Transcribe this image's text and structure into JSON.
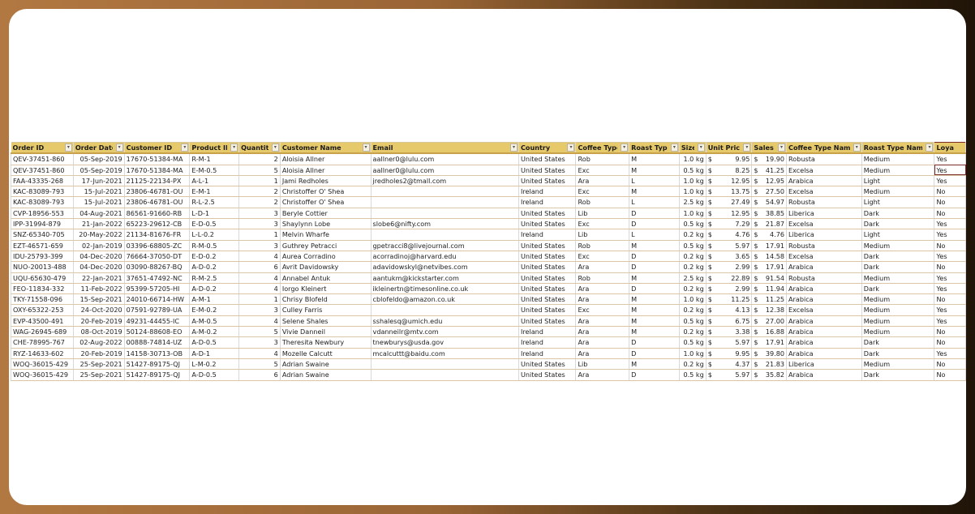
{
  "sheet": {
    "columns": [
      {
        "key": "order_id",
        "label": "Order ID"
      },
      {
        "key": "order_date",
        "label": "Order Date"
      },
      {
        "key": "customer_id",
        "label": "Customer ID"
      },
      {
        "key": "product_id",
        "label": "Product ID"
      },
      {
        "key": "quantity",
        "label": "Quantity"
      },
      {
        "key": "customer_name",
        "label": "Customer Name"
      },
      {
        "key": "email",
        "label": "Email"
      },
      {
        "key": "country",
        "label": "Country"
      },
      {
        "key": "coffee_type",
        "label": "Coffee Type"
      },
      {
        "key": "roast_type",
        "label": "Roast Type"
      },
      {
        "key": "size",
        "label": "Size"
      },
      {
        "key": "unit_price",
        "label": "Unit Price"
      },
      {
        "key": "sales",
        "label": "Sales"
      },
      {
        "key": "coffee_type_name",
        "label": "Coffee Type Name"
      },
      {
        "key": "roast_type_name",
        "label": "Roast Type Name"
      },
      {
        "key": "loyalty",
        "label": "Loyalty"
      }
    ],
    "filter_icon": "filter-dropdown-arrow",
    "currency_symbol": "$",
    "selected_cell": {
      "row": 1,
      "column": "loyalty"
    },
    "rows": [
      [
        "QEV-37451-860",
        "05-Sep-2019",
        "17670-51384-MA",
        "R-M-1",
        "2",
        "Aloisia Allner",
        "aallner0@lulu.com",
        "United States",
        "Rob",
        "M",
        "1.0 kg",
        "9.95",
        "19.90",
        "Robusta",
        "Medium",
        "Yes"
      ],
      [
        "QEV-37451-860",
        "05-Sep-2019",
        "17670-51384-MA",
        "E-M-0.5",
        "5",
        "Aloisia Allner",
        "aallner0@lulu.com",
        "United States",
        "Exc",
        "M",
        "0.5 kg",
        "8.25",
        "41.25",
        "Excelsa",
        "Medium",
        "Yes"
      ],
      [
        "FAA-43335-268",
        "17-Jun-2021",
        "21125-22134-PX",
        "A-L-1",
        "1",
        "Jami Redholes",
        "jredholes2@tmall.com",
        "United States",
        "Ara",
        "L",
        "1.0 kg",
        "12.95",
        "12.95",
        "Arabica",
        "Light",
        "Yes"
      ],
      [
        "KAC-83089-793",
        "15-Jul-2021",
        "23806-46781-OU",
        "E-M-1",
        "2",
        "Christoffer O' Shea",
        "",
        "Ireland",
        "Exc",
        "M",
        "1.0 kg",
        "13.75",
        "27.50",
        "Excelsa",
        "Medium",
        "No"
      ],
      [
        "KAC-83089-793",
        "15-Jul-2021",
        "23806-46781-OU",
        "R-L-2.5",
        "2",
        "Christoffer O' Shea",
        "",
        "Ireland",
        "Rob",
        "L",
        "2.5 kg",
        "27.49",
        "54.97",
        "Robusta",
        "Light",
        "No"
      ],
      [
        "CVP-18956-553",
        "04-Aug-2021",
        "86561-91660-RB",
        "L-D-1",
        "3",
        "Beryle Cottier",
        "",
        "United States",
        "Lib",
        "D",
        "1.0 kg",
        "12.95",
        "38.85",
        "Liberica",
        "Dark",
        "No"
      ],
      [
        "IPP-31994-879",
        "21-Jan-2022",
        "65223-29612-CB",
        "E-D-0.5",
        "3",
        "Shaylynn Lobe",
        "slobe6@nifty.com",
        "United States",
        "Exc",
        "D",
        "0.5 kg",
        "7.29",
        "21.87",
        "Excelsa",
        "Dark",
        "Yes"
      ],
      [
        "SNZ-65340-705",
        "20-May-2022",
        "21134-81676-FR",
        "L-L-0.2",
        "1",
        "Melvin Wharfe",
        "",
        "Ireland",
        "Lib",
        "L",
        "0.2 kg",
        "4.76",
        "4.76",
        "Liberica",
        "Light",
        "Yes"
      ],
      [
        "EZT-46571-659",
        "02-Jan-2019",
        "03396-68805-ZC",
        "R-M-0.5",
        "3",
        "Guthrey Petracci",
        "gpetracci8@livejournal.com",
        "United States",
        "Rob",
        "M",
        "0.5 kg",
        "5.97",
        "17.91",
        "Robusta",
        "Medium",
        "No"
      ],
      [
        "IDU-25793-399",
        "04-Dec-2020",
        "76664-37050-DT",
        "E-D-0.2",
        "4",
        "Aurea Corradino",
        "acorradinoj@harvard.edu",
        "United States",
        "Exc",
        "D",
        "0.2 kg",
        "3.65",
        "14.58",
        "Excelsa",
        "Dark",
        "Yes"
      ],
      [
        "NUO-20013-488",
        "04-Dec-2020",
        "03090-88267-BQ",
        "A-D-0.2",
        "6",
        "Avrit Davidowsky",
        "adavidowskyl@netvibes.com",
        "United States",
        "Ara",
        "D",
        "0.2 kg",
        "2.99",
        "17.91",
        "Arabica",
        "Dark",
        "No"
      ],
      [
        "UQU-65630-479",
        "22-Jan-2021",
        "37651-47492-NC",
        "R-M-2.5",
        "4",
        "Annabel Antuk",
        "aantukm@kickstarter.com",
        "United States",
        "Rob",
        "M",
        "2.5 kg",
        "22.89",
        "91.54",
        "Robusta",
        "Medium",
        "Yes"
      ],
      [
        "FEO-11834-332",
        "11-Feb-2022",
        "95399-57205-HI",
        "A-D-0.2",
        "4",
        "Iorgo Kleinert",
        "ikleinertn@timesonline.co.uk",
        "United States",
        "Ara",
        "D",
        "0.2 kg",
        "2.99",
        "11.94",
        "Arabica",
        "Dark",
        "Yes"
      ],
      [
        "TKY-71558-096",
        "15-Sep-2021",
        "24010-66714-HW",
        "A-M-1",
        "1",
        "Chrisy Blofeld",
        "cblofeldo@amazon.co.uk",
        "United States",
        "Ara",
        "M",
        "1.0 kg",
        "11.25",
        "11.25",
        "Arabica",
        "Medium",
        "No"
      ],
      [
        "OXY-65322-253",
        "24-Oct-2020",
        "07591-92789-UA",
        "E-M-0.2",
        "3",
        "Culley Farris",
        "",
        "United States",
        "Exc",
        "M",
        "0.2 kg",
        "4.13",
        "12.38",
        "Excelsa",
        "Medium",
        "Yes"
      ],
      [
        "EVP-43500-491",
        "20-Feb-2019",
        "49231-44455-IC",
        "A-M-0.5",
        "4",
        "Selene Shales",
        "sshalesq@umich.edu",
        "United States",
        "Ara",
        "M",
        "0.5 kg",
        "6.75",
        "27.00",
        "Arabica",
        "Medium",
        "Yes"
      ],
      [
        "WAG-26945-689",
        "08-Oct-2019",
        "50124-88608-EO",
        "A-M-0.2",
        "5",
        "Vivie Danneil",
        "vdanneilr@mtv.com",
        "Ireland",
        "Ara",
        "M",
        "0.2 kg",
        "3.38",
        "16.88",
        "Arabica",
        "Medium",
        "No"
      ],
      [
        "CHE-78995-767",
        "02-Aug-2022",
        "00888-74814-UZ",
        "A-D-0.5",
        "3",
        "Theresita Newbury",
        "tnewburys@usda.gov",
        "Ireland",
        "Ara",
        "D",
        "0.5 kg",
        "5.97",
        "17.91",
        "Arabica",
        "Dark",
        "No"
      ],
      [
        "RYZ-14633-602",
        "20-Feb-2019",
        "14158-30713-OB",
        "A-D-1",
        "4",
        "Mozelle Calcutt",
        "mcalcuttt@baidu.com",
        "Ireland",
        "Ara",
        "D",
        "1.0 kg",
        "9.95",
        "39.80",
        "Arabica",
        "Dark",
        "Yes"
      ],
      [
        "WOQ-36015-429",
        "25-Sep-2021",
        "51427-89175-QJ",
        "L-M-0.2",
        "5",
        "Adrian Swaine",
        "",
        "United States",
        "Lib",
        "M",
        "0.2 kg",
        "4.37",
        "21.83",
        "Liberica",
        "Medium",
        "No"
      ],
      [
        "WOQ-36015-429",
        "25-Sep-2021",
        "51427-89175-QJ",
        "A-D-0.5",
        "6",
        "Adrian Swaine",
        "",
        "United States",
        "Ara",
        "D",
        "0.5 kg",
        "5.97",
        "35.82",
        "Arabica",
        "Dark",
        "No"
      ]
    ]
  }
}
